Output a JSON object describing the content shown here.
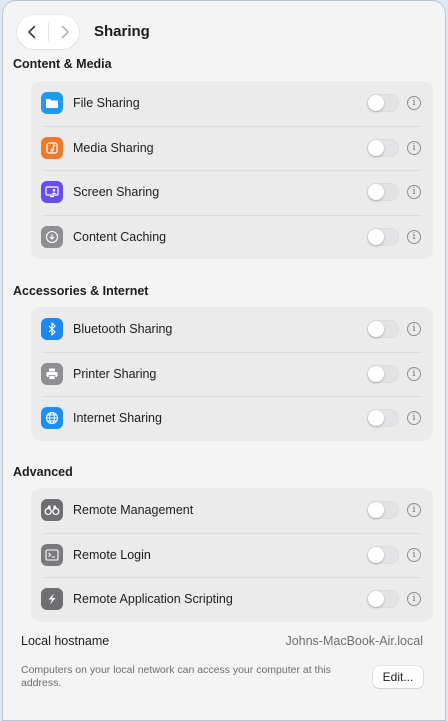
{
  "window": {
    "title": "Sharing"
  },
  "sections": [
    {
      "title": "Content & Media",
      "items": [
        {
          "label": "File Sharing",
          "icon": "folder-icon",
          "color": "#1e9bf0"
        },
        {
          "label": "Media Sharing",
          "icon": "music-note-icon",
          "color": "#f07a2a"
        },
        {
          "label": "Screen Sharing",
          "icon": "screen-person-icon",
          "color": "#6a4cf0"
        },
        {
          "label": "Content Caching",
          "icon": "download-circle-icon",
          "color": "#8e8e93"
        }
      ]
    },
    {
      "title": "Accessories & Internet",
      "items": [
        {
          "label": "Bluetooth Sharing",
          "icon": "bluetooth-icon",
          "color": "#1e87f0"
        },
        {
          "label": "Printer Sharing",
          "icon": "printer-icon",
          "color": "#8e8e93"
        },
        {
          "label": "Internet Sharing",
          "icon": "globe-icon",
          "color": "#1e8ef0"
        }
      ]
    },
    {
      "title": "Advanced",
      "items": [
        {
          "label": "Remote Management",
          "icon": "binoculars-icon",
          "color": "#6f6f73"
        },
        {
          "label": "Remote Login",
          "icon": "terminal-icon",
          "color": "#7a7a7e"
        },
        {
          "label": "Remote Application Scripting",
          "icon": "script-icon",
          "color": "#6f6f73"
        }
      ]
    }
  ],
  "hostname": {
    "label": "Local hostname",
    "value": "Johns-MacBook-Air.local",
    "description": "Computers on your local network can access your computer at this address.",
    "edit_label": "Edit..."
  },
  "colors": {
    "toggle_off": "#e3e3e5",
    "group_bg": "#ebebec",
    "window_bg": "#f4f4f5"
  }
}
